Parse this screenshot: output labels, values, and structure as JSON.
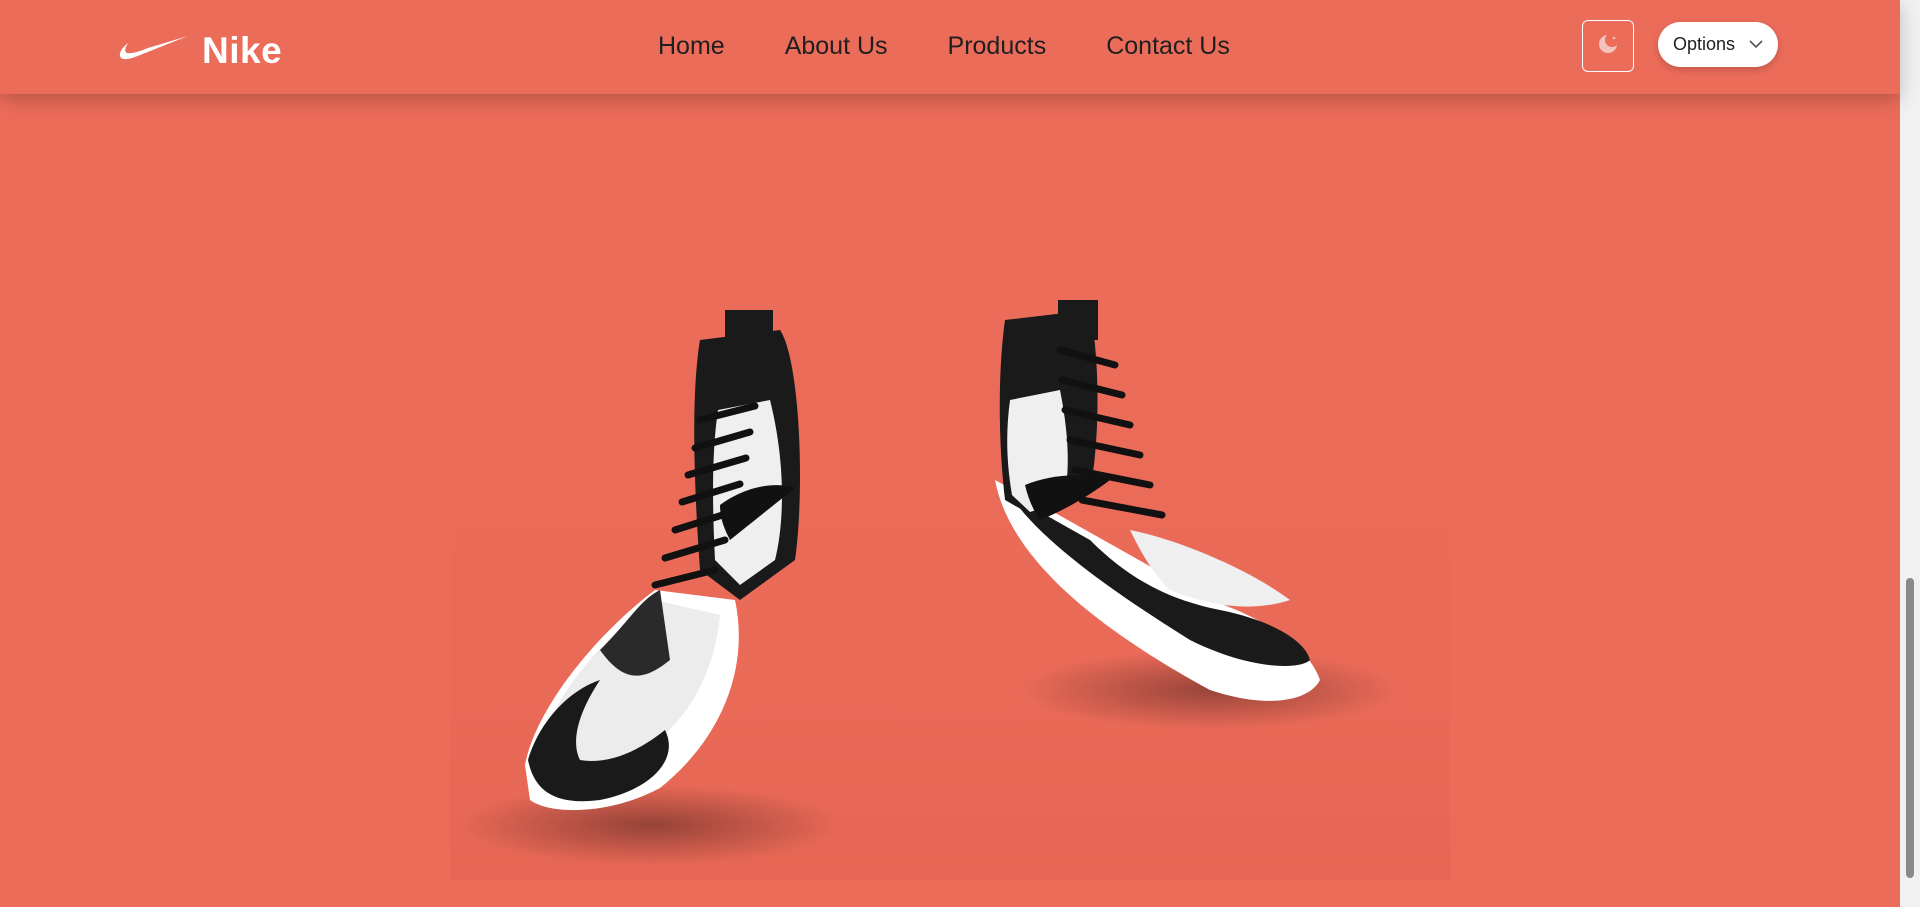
{
  "brand": {
    "name": "Nike",
    "logo_icon": "swoosh-icon"
  },
  "nav": {
    "items": [
      {
        "label": "Home"
      },
      {
        "label": "About Us"
      },
      {
        "label": "Products"
      },
      {
        "label": "Contact Us"
      }
    ]
  },
  "controls": {
    "theme_icon": "moon-icon",
    "options_label": "Options",
    "options_icon": "chevron-down-icon"
  },
  "colors": {
    "background": "#ec6c5a",
    "accent": "#ffffff",
    "text": "#1f1f1f"
  }
}
